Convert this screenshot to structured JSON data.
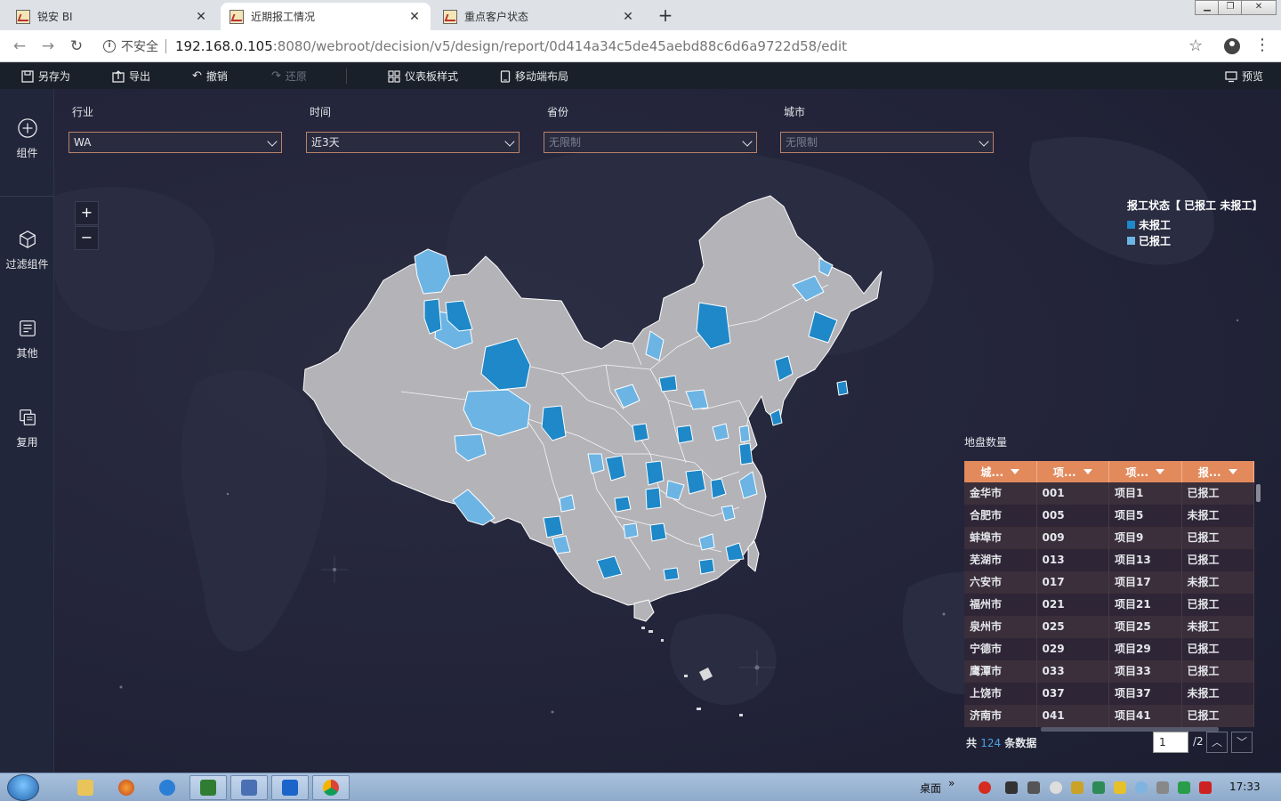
{
  "browser": {
    "tabs": [
      {
        "label": "锐安 BI",
        "active": false
      },
      {
        "label": "近期报工情况",
        "active": true
      },
      {
        "label": "重点客户状态",
        "active": false
      }
    ],
    "new_tab": "+",
    "close": "✕",
    "url_security": "不安全",
    "url_host": "192.168.0.105",
    "url_path": ":8080/webroot/decision/v5/design/report/0d414a34c5de45aebd88c6d6a9722d58/edit"
  },
  "toolbar": {
    "save_as": "另存为",
    "export": "导出",
    "undo": "撤销",
    "redo": "还原",
    "dashboard_style": "仪表板样式",
    "mobile_layout": "移动端布局",
    "preview": "预览"
  },
  "sidebar": {
    "items": [
      {
        "label": "组件",
        "icon": "plus-circle-icon"
      },
      {
        "label": "过滤组件",
        "icon": "cube-icon"
      },
      {
        "label": "其他",
        "icon": "document-icon"
      },
      {
        "label": "复用",
        "icon": "copy-icon"
      }
    ]
  },
  "filters": [
    {
      "label": "行业",
      "value": "WA",
      "placeholder": false
    },
    {
      "label": "时间",
      "value": "近3天",
      "placeholder": false
    },
    {
      "label": "省份",
      "value": "无限制",
      "placeholder": true
    },
    {
      "label": "城市",
      "value": "无限制",
      "placeholder": true
    }
  ],
  "zoom": {
    "in": "+",
    "out": "−"
  },
  "legend": {
    "title": "报工状态【 已报工 未报工】",
    "items": [
      {
        "label": "未报工",
        "color": "#1e88c8"
      },
      {
        "label": "已报工",
        "color": "#6cb4e4"
      }
    ]
  },
  "colors": {
    "region_default": "#b3b3b8",
    "not_reported": "#1e88c8",
    "reported": "#6cb4e4",
    "table_header": "#e38a5d"
  },
  "table": {
    "title": "地盘数量",
    "headers": [
      "城...",
      "项...",
      "项...",
      "报..."
    ],
    "rows": [
      [
        "金华市",
        "001",
        "项目1",
        "已报工"
      ],
      [
        "合肥市",
        "005",
        "项目5",
        "未报工"
      ],
      [
        "蚌埠市",
        "009",
        "项目9",
        "已报工"
      ],
      [
        "芜湖市",
        "013",
        "项目13",
        "已报工"
      ],
      [
        "六安市",
        "017",
        "项目17",
        "未报工"
      ],
      [
        "福州市",
        "021",
        "项目21",
        "已报工"
      ],
      [
        "泉州市",
        "025",
        "项目25",
        "未报工"
      ],
      [
        "宁德市",
        "029",
        "项目29",
        "已报工"
      ],
      [
        "鹰潭市",
        "033",
        "项目33",
        "已报工"
      ],
      [
        "上饶市",
        "037",
        "项目37",
        "未报工"
      ],
      [
        "济南市",
        "041",
        "项目41",
        "已报工"
      ]
    ],
    "total_prefix": "共",
    "total_count": "124",
    "total_suffix": "条数据",
    "page": "1",
    "page_total": "/2"
  },
  "taskbar": {
    "desktop_label": "桌面",
    "clock": "17:33"
  }
}
